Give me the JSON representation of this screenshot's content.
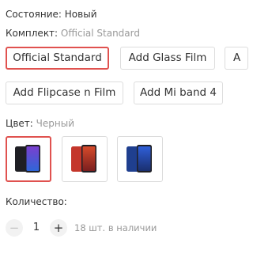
{
  "condition": {
    "label": "Состояние:",
    "value": "Новый"
  },
  "kit": {
    "label": "Комплект:",
    "selected": "Official Standard",
    "options": [
      "Official Standard",
      "Add Glass Film",
      "A",
      "Add Flipcase n Film",
      "Add Mi band 4"
    ]
  },
  "color": {
    "label": "Цвет:",
    "selected": "Черный",
    "swatches": [
      {
        "name": "black",
        "body": "#1f1f24",
        "screen_top": "#7a3fcf",
        "screen_bottom": "#2f66d8"
      },
      {
        "name": "red",
        "body": "#c4362b",
        "screen_top": "#d64a2a",
        "screen_bottom": "#7a1f1f"
      },
      {
        "name": "blue",
        "body": "#1f3f8f",
        "screen_top": "#2f5fd8",
        "screen_bottom": "#1a2f6f"
      }
    ]
  },
  "quantity": {
    "label": "Количество:",
    "value": "1",
    "minus": "−",
    "plus": "+",
    "stock": "18 шт. в наличии"
  },
  "colors": {
    "accent": "#e0524f",
    "border": "#dcdcdc",
    "muted": "#999999"
  }
}
